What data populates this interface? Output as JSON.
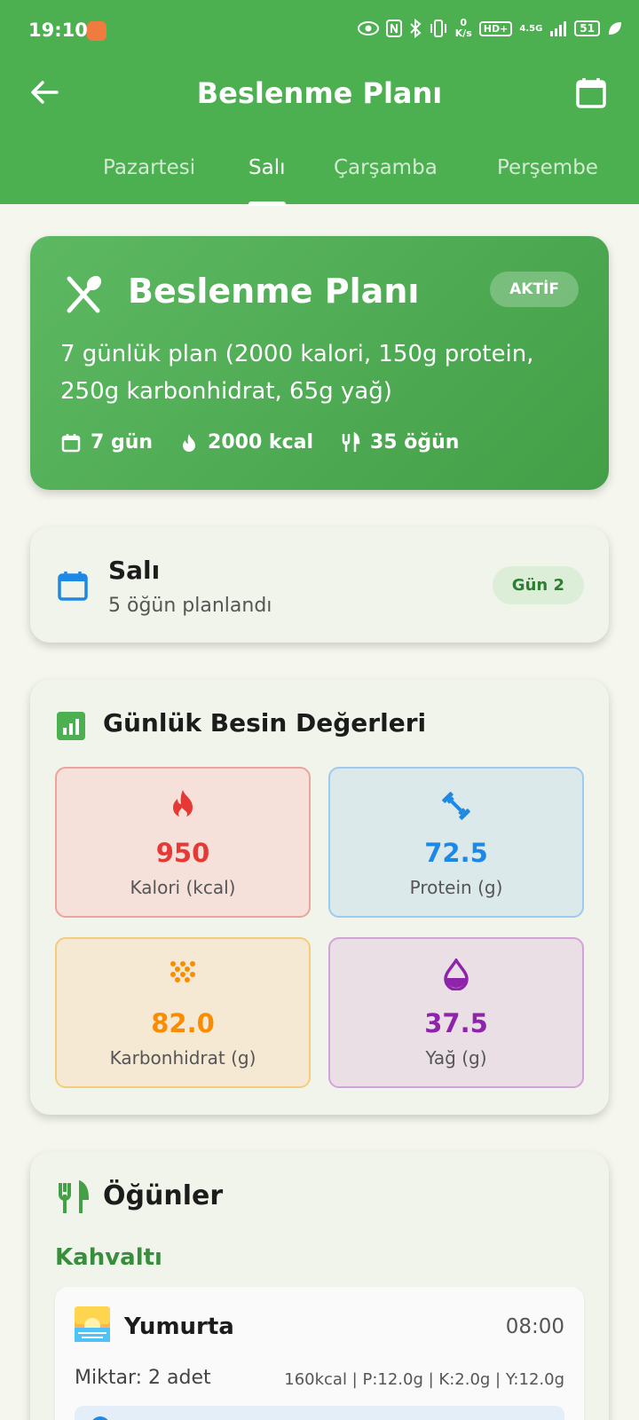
{
  "status_bar": {
    "time": "19:10",
    "net_speed_value": "0",
    "net_speed_unit": "K/s",
    "hd_label": "HD+",
    "network_type": "4.5G",
    "battery": "51"
  },
  "app_bar": {
    "title": "Beslenme Planı"
  },
  "tabs": [
    {
      "label": "Pazartesi"
    },
    {
      "label": "Salı"
    },
    {
      "label": "Çarşamba"
    },
    {
      "label": "Perşembe"
    }
  ],
  "active_tab": "Salı",
  "plan": {
    "title": "Beslenme Planı",
    "badge": "AKTİF",
    "description": "7 günlük plan (2000 kalori, 150g protein, 250g karbonhidrat, 65g yağ)",
    "stats": {
      "days": "7 gün",
      "calories": "2000 kcal",
      "meals": "35 öğün"
    }
  },
  "day": {
    "name": "Salı",
    "subtitle": "5 öğün planlandı",
    "badge": "Gün 2"
  },
  "nutrition": {
    "title": "Günlük Besin Değerleri",
    "tiles": {
      "kalori": {
        "value": "950",
        "label": "Kalori (kcal)"
      },
      "protein": {
        "value": "72.5",
        "label": "Protein (g)"
      },
      "karbonhidrat": {
        "value": "82.0",
        "label": "Karbonhidrat (g)"
      },
      "yag": {
        "value": "37.5",
        "label": "Yağ (g)"
      }
    },
    "colors": {
      "kalori": "#e53935",
      "protein": "#1e88e5",
      "karbonhidrat": "#fb8c00",
      "yag": "#8e24aa"
    }
  },
  "meals": {
    "title": "Öğünler",
    "section": "Kahvaltı",
    "item": {
      "name": "Yumurta",
      "time": "08:00",
      "quantity": "Miktar: 2 adet",
      "macros": "160kcal | P:12.0g | K:2.0g | Y:12.0g"
    }
  },
  "colors": {
    "primary": "#4caf50",
    "primary_dark": "#388e3c"
  },
  "icons": {
    "back": "arrow-left-icon",
    "calendar": "calendar-icon",
    "plan": "fork-knife-icon",
    "fire": "fire-icon",
    "dumbbell": "dumbbell-icon",
    "grain": "grain-icon",
    "drop": "drop-icon",
    "bar_chart": "bar-chart-icon",
    "sunrise": "sunrise-icon"
  }
}
